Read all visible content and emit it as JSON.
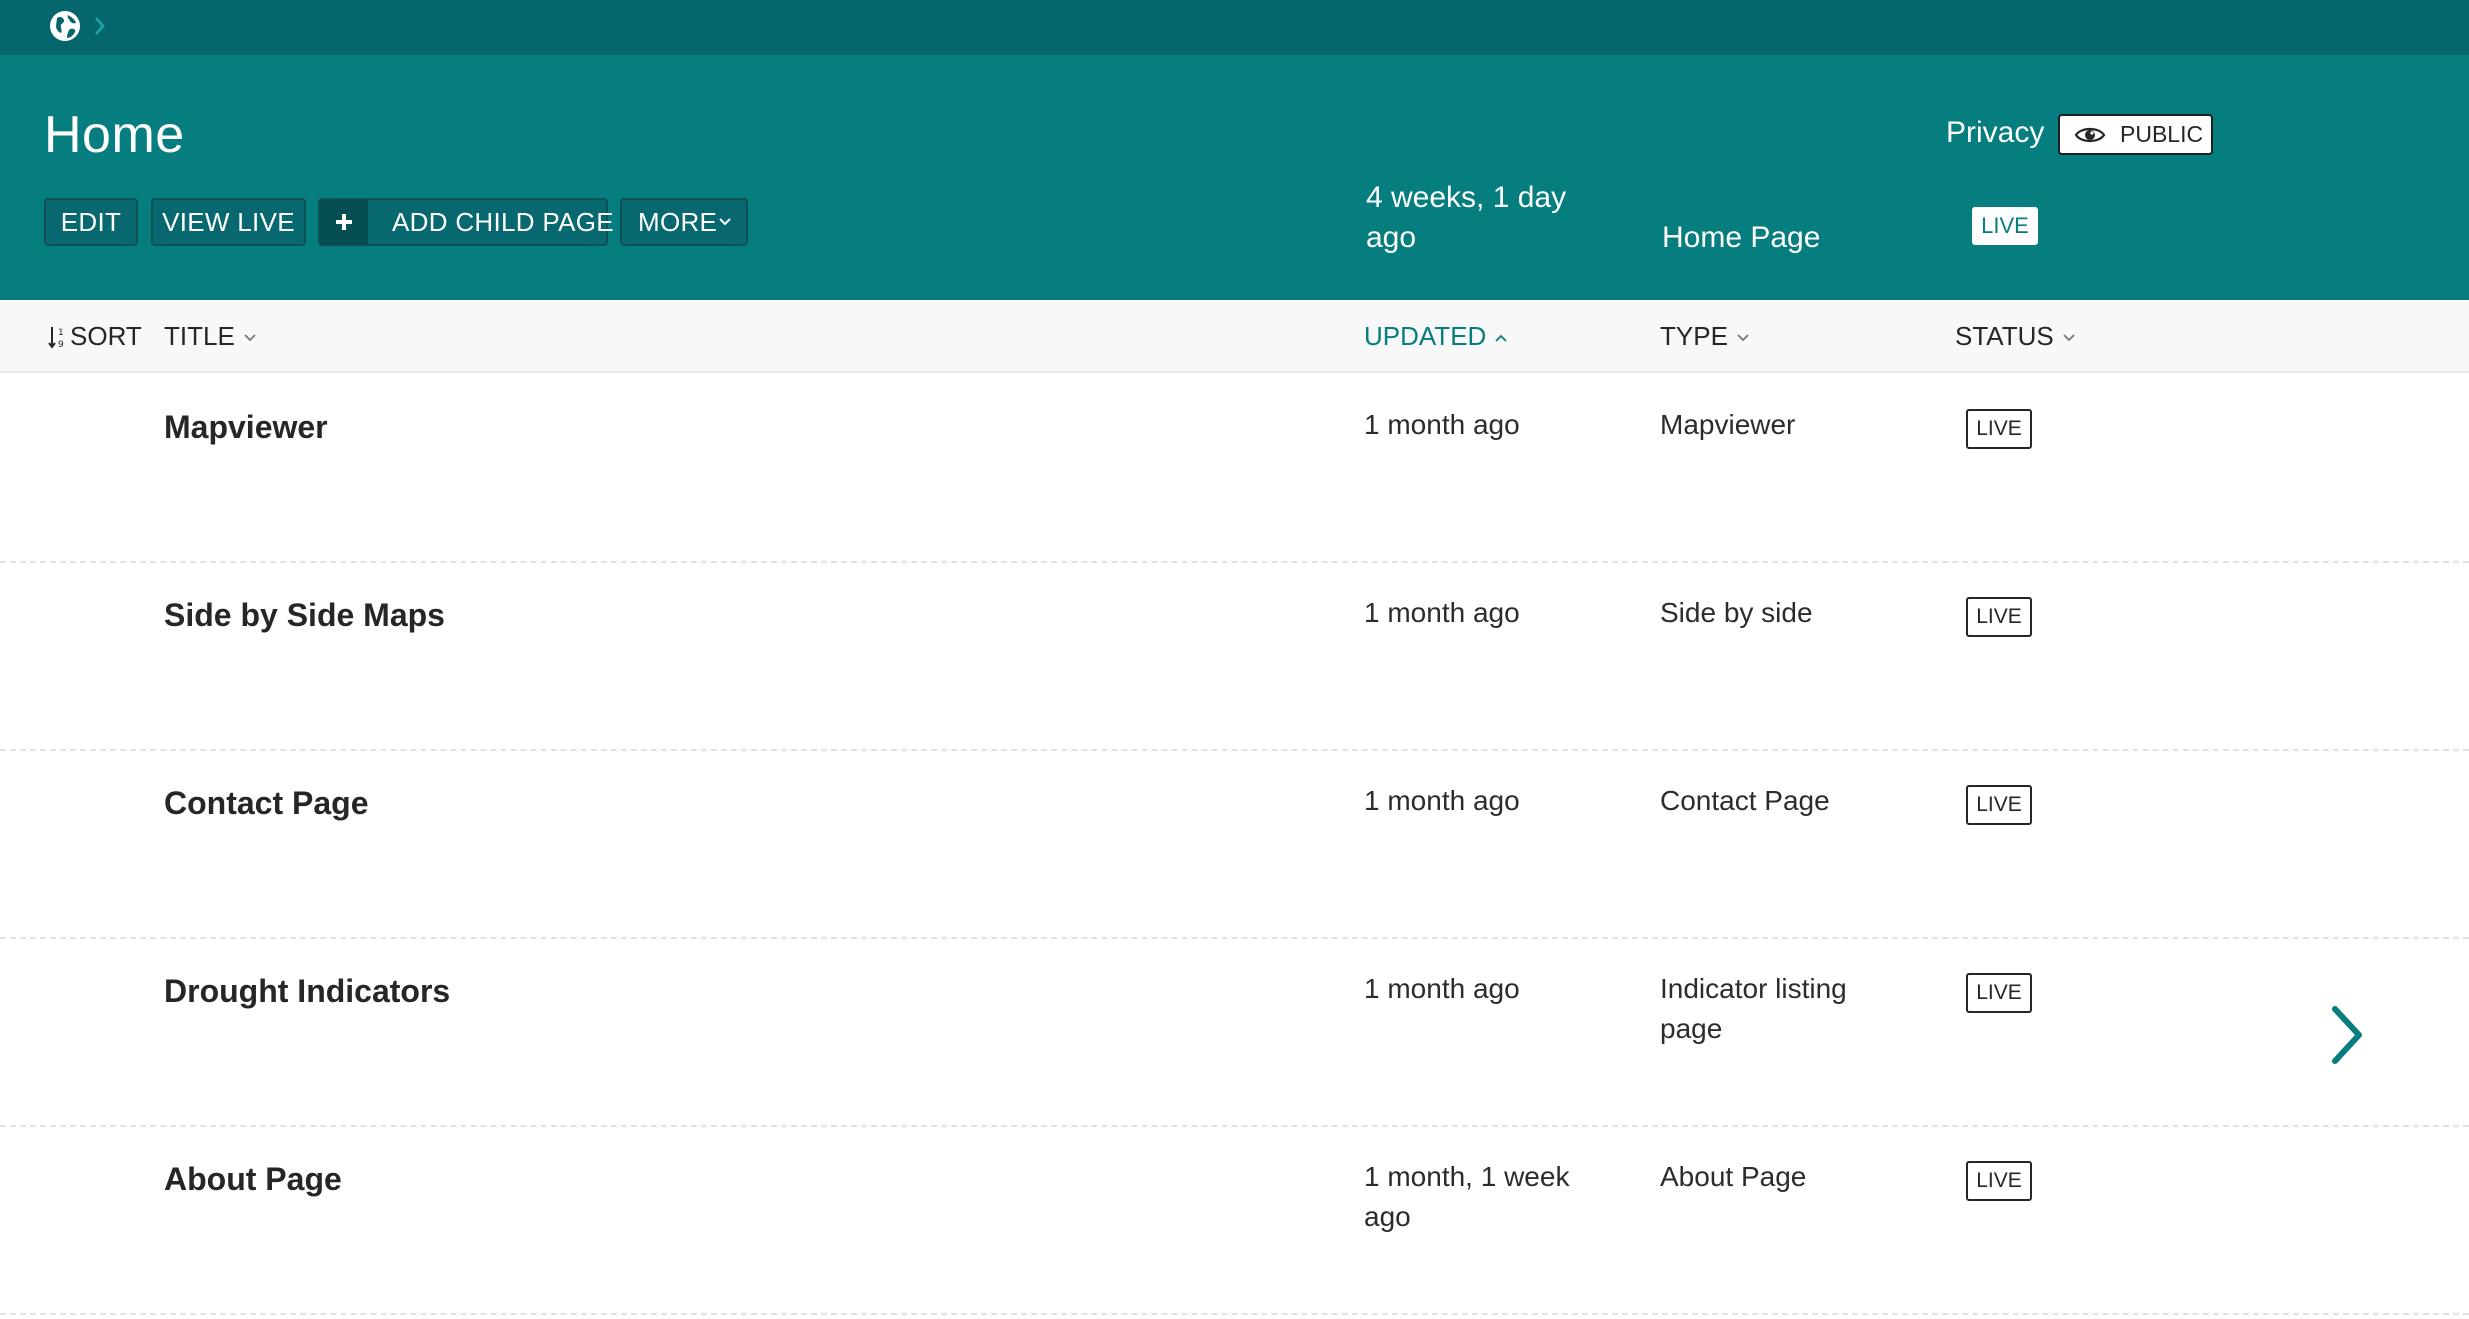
{
  "breadcrumb": {
    "root_icon": "globe-icon",
    "separator_icon": "chevron-right-icon"
  },
  "header": {
    "title": "Home",
    "actions": {
      "edit": "EDIT",
      "view_live": "VIEW LIVE",
      "add_child_page": "ADD CHILD PAGE",
      "more": "MORE"
    },
    "updated": "4 weeks, 1 day ago",
    "type": "Home Page",
    "status": "LIVE",
    "privacy_label": "Privacy",
    "privacy_value": "PUBLIC"
  },
  "columns": {
    "sort": "SORT",
    "title": "TITLE",
    "updated": "UPDATED",
    "type": "TYPE",
    "status": "STATUS"
  },
  "rows": [
    {
      "title": "Mapviewer",
      "updated": "1 month ago",
      "type": "Mapviewer",
      "status": "LIVE",
      "has_children": false
    },
    {
      "title": "Side by Side Maps",
      "updated": "1 month ago",
      "type": "Side by side",
      "status": "LIVE",
      "has_children": false
    },
    {
      "title": "Contact Page",
      "updated": "1 month ago",
      "type": "Contact Page",
      "status": "LIVE",
      "has_children": false
    },
    {
      "title": "Drought Indicators",
      "updated": "1 month ago",
      "type": "Indicator listing page",
      "status": "LIVE",
      "has_children": true
    },
    {
      "title": "About Page",
      "updated": "1 month, 1 week ago",
      "type": "About Page",
      "status": "LIVE",
      "has_children": false
    }
  ],
  "colors": {
    "topbar": "#05666e",
    "header": "#067d7e",
    "accent": "#067d7e",
    "button_dark": "#054e53"
  }
}
